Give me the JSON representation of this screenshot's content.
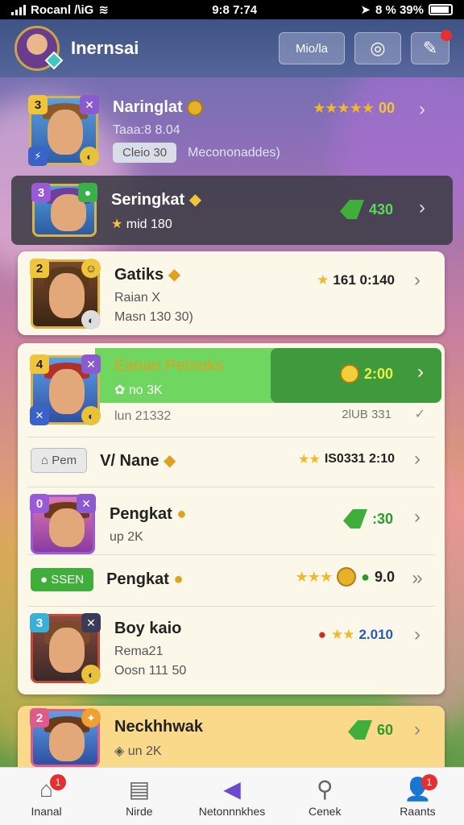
{
  "status_bar": {
    "carrier": "Rocanl /\\iG",
    "time": "9:8 7:74",
    "battery": "8 % 39%"
  },
  "header": {
    "title": "Inernsai",
    "button_text": "Mio/la"
  },
  "rows": [
    {
      "name": "Naringlat",
      "line1": "Taaa:8 8.04",
      "pill": "Cleio 30",
      "line2": "Mecononaddes)",
      "score": "00",
      "stars": "★★★★★",
      "level": "3"
    },
    {
      "name": "Seringkat",
      "line1": "mid 180",
      "score": "430",
      "level": "3"
    },
    {
      "name": "Gatiks",
      "line1": "Raian X",
      "line2": "Masn 130 30)",
      "score": "161 0:140",
      "level": "2"
    },
    {
      "name": "Eanan Pemoks",
      "line1": "no 3K",
      "line2": "lun 21332",
      "score": "2:00",
      "right2": "2lUB 331",
      "level": "4"
    },
    {
      "name": "V/ Nane",
      "tag": "Pem",
      "score": "IS0331 2:10",
      "stars": "★★"
    },
    {
      "name": "Pengkat",
      "line1": "up 2K",
      "score": ":30",
      "level": "0"
    },
    {
      "name": "Pengkat",
      "tag": "SSEN",
      "score": "9.0",
      "stars": "★★★"
    },
    {
      "name": "Boy kaio",
      "line1": "Rema21",
      "line2": "Oosn 111 50",
      "score": "2.010",
      "stars": "★★",
      "level": "3"
    },
    {
      "name": "Neckhhwak",
      "line1": "un 2K",
      "score": "60",
      "level": "2"
    }
  ],
  "tabs": [
    {
      "label": "Inanal",
      "badge": "1"
    },
    {
      "label": "Nirde"
    },
    {
      "label": "Netonnnkhes"
    },
    {
      "label": "Cenek"
    },
    {
      "label": "Raants",
      "badge": "1"
    }
  ],
  "colors": {
    "accent_green": "#3fae3a",
    "highlight_green": "#5ac35a",
    "gold": "#f0b82a",
    "header": "#4a5f98"
  }
}
